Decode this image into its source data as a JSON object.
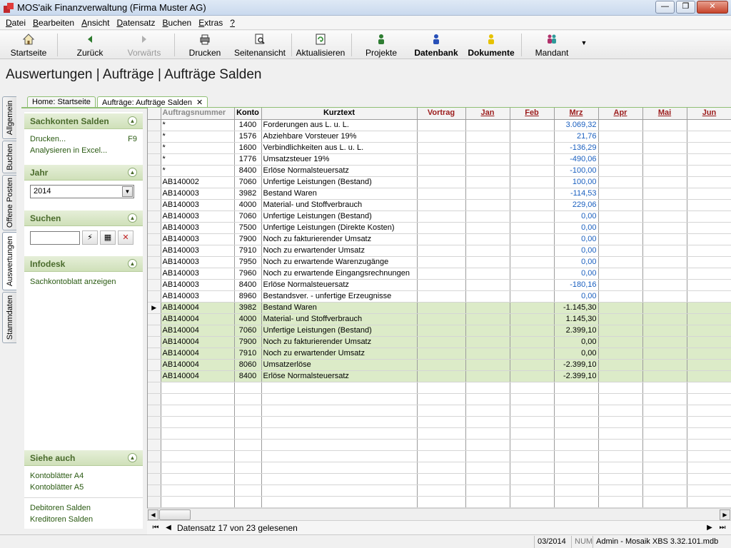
{
  "window": {
    "title": "MOS'aik Finanzverwaltung (Firma Muster AG)",
    "minimize": "—",
    "maximize": "❐",
    "close": "✕"
  },
  "menu": [
    {
      "label": "Datei",
      "u": "D",
      "rest": "atei"
    },
    {
      "label": "Bearbeiten",
      "u": "B",
      "rest": "earbeiten"
    },
    {
      "label": "Ansicht",
      "u": "A",
      "rest": "nsicht"
    },
    {
      "label": "Datensatz",
      "u": "D",
      "rest": "atensatz"
    },
    {
      "label": "Buchen",
      "u": "B",
      "rest": "uchen"
    },
    {
      "label": "Extras",
      "u": "E",
      "rest": "xtras"
    },
    {
      "label": "?",
      "u": "?",
      "rest": ""
    }
  ],
  "toolbar": {
    "startseite": "Startseite",
    "zurueck": "Zurück",
    "vorwaerts": "Vorwärts",
    "drucken": "Drucken",
    "seitenansicht": "Seitenansicht",
    "aktualisieren": "Aktualisieren",
    "projekte": "Projekte",
    "datenbank": "Datenbank",
    "dokumente": "Dokumente",
    "mandant": "Mandant"
  },
  "page": {
    "header": "Auswertungen | Aufträge | Aufträge Salden"
  },
  "vtabs": [
    "Allgemein",
    "Buchen",
    "Offene Posten",
    "Auswertungen",
    "Stammdaten"
  ],
  "doctabs": {
    "home": "Home: Startseite",
    "active": "Aufträge: Aufträge Salden",
    "close": "✕"
  },
  "panel": {
    "sachkonten": {
      "title": "Sachkonten Salden",
      "drucken": "Drucken...",
      "drucken_key": "F9",
      "excel": "Analysieren in Excel..."
    },
    "jahr": {
      "title": "Jahr",
      "value": "2014"
    },
    "suchen": {
      "title": "Suchen"
    },
    "infodesk": {
      "title": "Infodesk",
      "link": "Sachkontoblatt anzeigen"
    },
    "siehe": {
      "title": "Siehe auch",
      "links": [
        "Kontoblätter A4",
        "Kontoblätter A5",
        "Debitoren Salden",
        "Kreditoren Salden"
      ]
    }
  },
  "grid": {
    "columns": [
      "Auftragsnummer",
      "Konto",
      "Kurztext",
      "Vortrag",
      "Jan",
      "Feb",
      "Mrz",
      "Apr",
      "Mai",
      "Jun"
    ],
    "rows": [
      {
        "auftrag": "*",
        "konto": "1400",
        "text": "Forderungen aus L. u. L.",
        "mrz": "3.069,32",
        "blue": true
      },
      {
        "auftrag": "*",
        "konto": "1576",
        "text": "Abziehbare Vorsteuer 19%",
        "mrz": "21,76",
        "blue": true
      },
      {
        "auftrag": "*",
        "konto": "1600",
        "text": "Verbindlichkeiten aus L. u. L.",
        "mrz": "-136,29",
        "blue": true
      },
      {
        "auftrag": "*",
        "konto": "1776",
        "text": "Umsatzsteuer 19%",
        "mrz": "-490,06",
        "blue": true
      },
      {
        "auftrag": "*",
        "konto": "8400",
        "text": "Erlöse Normalsteuersatz",
        "mrz": "-100,00",
        "blue": true
      },
      {
        "auftrag": "AB140002",
        "konto": "7060",
        "text": "Unfertige Leistungen (Bestand)",
        "mrz": "100,00",
        "blue": true
      },
      {
        "auftrag": "AB140003",
        "konto": "3982",
        "text": "Bestand Waren",
        "mrz": "-114,53",
        "blue": true
      },
      {
        "auftrag": "AB140003",
        "konto": "4000",
        "text": "Material- und Stoffverbrauch",
        "mrz": "229,06",
        "blue": true
      },
      {
        "auftrag": "AB140003",
        "konto": "7060",
        "text": "Unfertige Leistungen (Bestand)",
        "mrz": "0,00",
        "blue": true
      },
      {
        "auftrag": "AB140003",
        "konto": "7500",
        "text": "Unfertige Leistungen (Direkte Kosten)",
        "mrz": "0,00",
        "blue": true
      },
      {
        "auftrag": "AB140003",
        "konto": "7900",
        "text": "Noch zu fakturierender Umsatz",
        "mrz": "0,00",
        "blue": true
      },
      {
        "auftrag": "AB140003",
        "konto": "7910",
        "text": "Noch zu erwartender Umsatz",
        "mrz": "0,00",
        "blue": true
      },
      {
        "auftrag": "AB140003",
        "konto": "7950",
        "text": "Noch zu erwartende Warenzugänge",
        "mrz": "0,00",
        "blue": true
      },
      {
        "auftrag": "AB140003",
        "konto": "7960",
        "text": "Noch zu erwartende Eingangsrechnungen",
        "mrz": "0,00",
        "blue": true
      },
      {
        "auftrag": "AB140003",
        "konto": "8400",
        "text": "Erlöse Normalsteuersatz",
        "mrz": "-180,16",
        "blue": true
      },
      {
        "auftrag": "AB140003",
        "konto": "8960",
        "text": "Bestandsver. - unfertige Erzeugnisse",
        "mrz": "0,00",
        "blue": true
      },
      {
        "auftrag": "AB140004",
        "konto": "3982",
        "text": "Bestand Waren",
        "mrz": "-1.145,30",
        "green": true,
        "current": true
      },
      {
        "auftrag": "AB140004",
        "konto": "4000",
        "text": "Material- und Stoffverbrauch",
        "mrz": "1.145,30",
        "green": true
      },
      {
        "auftrag": "AB140004",
        "konto": "7060",
        "text": "Unfertige Leistungen (Bestand)",
        "mrz": "2.399,10",
        "green": true
      },
      {
        "auftrag": "AB140004",
        "konto": "7900",
        "text": "Noch zu fakturierender Umsatz",
        "mrz": "0,00",
        "green": true
      },
      {
        "auftrag": "AB140004",
        "konto": "7910",
        "text": "Noch zu erwartender Umsatz",
        "mrz": "0,00",
        "green": true
      },
      {
        "auftrag": "AB140004",
        "konto": "8060",
        "text": "Umsatzerlöse",
        "mrz": "-2.399,10",
        "green": true
      },
      {
        "auftrag": "AB140004",
        "konto": "8400",
        "text": "Erlöse Normalsteuersatz",
        "mrz": "-2.399,10",
        "green": true
      }
    ],
    "nav_text": "Datensatz 17 von 23 gelesenen"
  },
  "status": {
    "period": "03/2014",
    "num": "NUM",
    "user": "Admin - Mosaik XBS 3.32.101.mdb"
  },
  "colors": {
    "accent_green": "#4a6b2c",
    "row_green": "#dcebc8",
    "value_blue": "#1a5fbf",
    "header_red": "#9b1b1b"
  }
}
